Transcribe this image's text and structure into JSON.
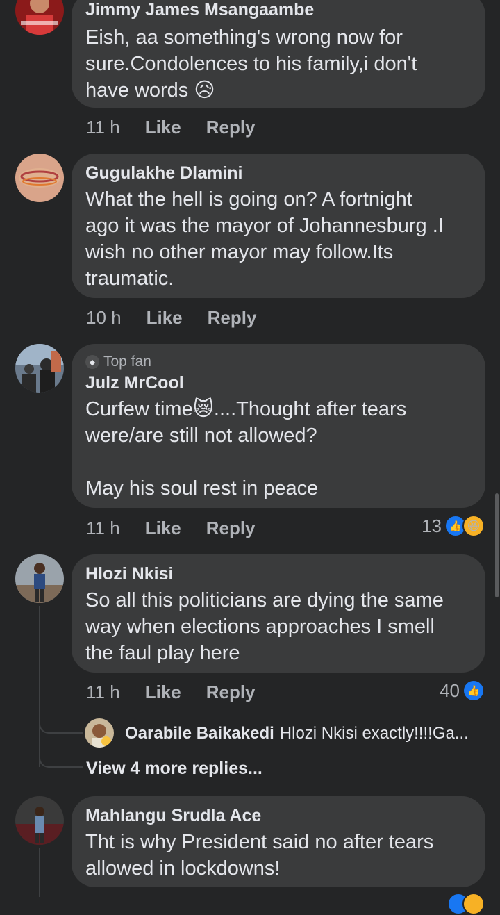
{
  "comments": [
    {
      "name": "Jimmy James Msangaambe",
      "text": "Eish, aa something's wrong now for\nsure.Condolences to his family,i don't\nhave words 😥",
      "time": "11 h",
      "like": "Like",
      "reply": "Reply"
    },
    {
      "name": "Gugulakhe Dlamini",
      "text": "What the hell is going on? A fortnight\nago it was the mayor of Johannesburg .I\nwish no other mayor may follow.Its\ntraumatic.",
      "time": "10 h",
      "like": "Like",
      "reply": "Reply"
    },
    {
      "badge": "Top fan",
      "name": "Julz MrCool",
      "text": "Curfew time😿....Thought after tears\nwere/are still not allowed?\n\nMay his soul rest in peace",
      "time": "11 h",
      "like": "Like",
      "reply": "Reply",
      "reaction_count": "13"
    },
    {
      "name": "Hlozi Nkisi",
      "text": "So all this politicians are dying the same\nway when elections approaches I smell\nthe faul play here",
      "time": "11 h",
      "like": "Like",
      "reply": "Reply",
      "reaction_count": "40",
      "reply_preview": {
        "name": "Oarabile Baikakedi",
        "text": "Hlozi Nkisi exactly!!!!Ga..."
      },
      "view_more": "View 4 more replies..."
    },
    {
      "name": "Mahlangu Srudla Ace",
      "text": "Tht is why President said no after tears\nallowed in lockdowns!"
    }
  ]
}
